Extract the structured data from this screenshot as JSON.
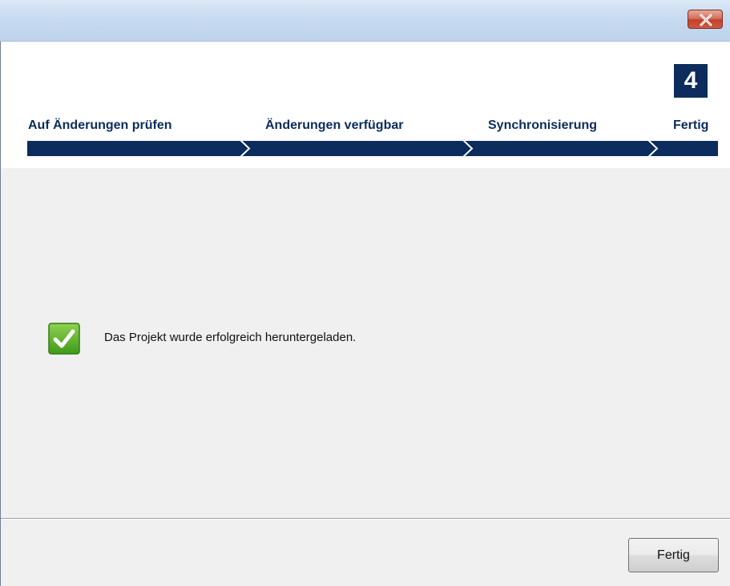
{
  "window": {
    "close_icon": "close-x-icon"
  },
  "wizard": {
    "current_step_number": "4",
    "steps": [
      {
        "label": "Auf Änderungen prüfen"
      },
      {
        "label": "Änderungen verfügbar"
      },
      {
        "label": "Synchronisierung"
      },
      {
        "label": "Fertig"
      }
    ],
    "progress_color": "#0b2c5c"
  },
  "content": {
    "status_icon": "green-checkmark-icon",
    "message": "Das Projekt wurde erfolgreich heruntergeladen."
  },
  "footer": {
    "finish_label": "Fertig"
  }
}
